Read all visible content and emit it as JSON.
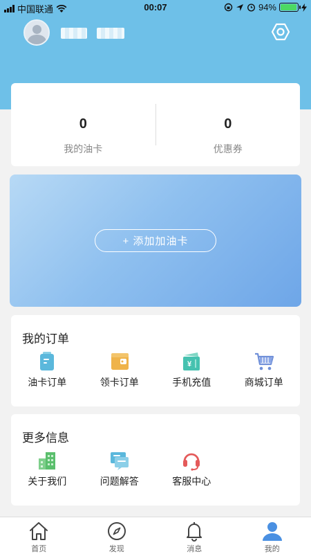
{
  "status_bar": {
    "carrier": "中国联通",
    "time": "00:07",
    "battery": "94%",
    "battery_level": 0.94
  },
  "colors": {
    "header": "#6ec0e8",
    "accent_blue": "#4a90e2",
    "battery_green": "#4cd964"
  },
  "profile": {
    "avatar_icon": "user-avatar-icon",
    "settings_icon": "hexagon-settings-icon"
  },
  "stats": [
    {
      "value": "0",
      "label": "我的油卡"
    },
    {
      "value": "0",
      "label": "优惠券"
    }
  ],
  "oil_card": {
    "add_label": "+ 添加加油卡"
  },
  "orders": {
    "title": "我的订单",
    "items": [
      {
        "label": "油卡订单",
        "icon": "fuel-card-order-icon"
      },
      {
        "label": "领卡订单",
        "icon": "wallet-card-icon"
      },
      {
        "label": "手机充值",
        "icon": "phone-recharge-icon"
      },
      {
        "label": "商城订单",
        "icon": "shopping-cart-icon"
      }
    ]
  },
  "more_info": {
    "title": "更多信息",
    "items": [
      {
        "label": "关于我们",
        "icon": "buildings-icon"
      },
      {
        "label": "问题解答",
        "icon": "faq-chat-icon"
      },
      {
        "label": "客服中心",
        "icon": "headset-icon"
      }
    ]
  },
  "tabbar": [
    {
      "label": "首页",
      "icon": "home-icon"
    },
    {
      "label": "发现",
      "icon": "compass-icon"
    },
    {
      "label": "消息",
      "icon": "bell-icon"
    },
    {
      "label": "我的",
      "icon": "profile-icon",
      "active": true
    }
  ]
}
